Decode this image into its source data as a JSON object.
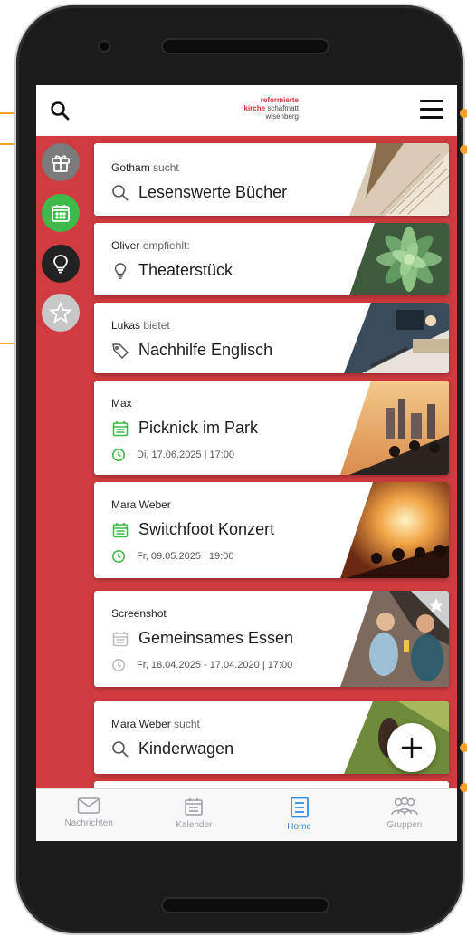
{
  "logo": {
    "line1": "reformierte",
    "line2a": "kirche",
    "line2b": "schafmatt",
    "line3": "wisenberg"
  },
  "accent": "#cf3b3f",
  "active_color": "#2f8fe8",
  "filters": [
    {
      "icon": "gift-icon",
      "color": "#7b7b7b"
    },
    {
      "icon": "calendar-icon",
      "color": "#3fb94a"
    },
    {
      "icon": "lightbulb-icon",
      "color": "#222222"
    },
    {
      "icon": "star-icon",
      "color": "#c7c7c7"
    }
  ],
  "cards": [
    {
      "author": "Gotham",
      "verb": "sucht",
      "icon": "search-icon",
      "title": "Lesenswerte Bücher"
    },
    {
      "author": "Oliver",
      "verb": "empfiehlt:",
      "icon": "lightbulb-icon",
      "title": "Theaterstück"
    },
    {
      "author": "Lukas",
      "verb": "bietet",
      "icon": "tag-icon",
      "title": "Nachhilfe Englisch"
    },
    {
      "author": "Max",
      "verb": "",
      "icon": "calendar-icon",
      "title": "Picknick im Park",
      "date": "Di, 17.06.2025 | 17:00"
    },
    {
      "author": "Mara Weber",
      "verb": "",
      "icon": "calendar-icon",
      "title": "Switchfoot Konzert",
      "date": "Fr, 09.05.2025 | 19:00"
    },
    {
      "author": "Screenshot",
      "verb": "",
      "icon": "calendar-icon",
      "title": "Gemeinsames Essen",
      "date": "Fr, 18.04.2025 - 17.04.2020 | 17:00",
      "starred": true
    },
    {
      "author": "Mara Weber",
      "verb": "sucht",
      "icon": "search-icon",
      "title": "Kinderwagen"
    }
  ],
  "nav": [
    {
      "label": "Nachrichten",
      "icon": "mail-icon"
    },
    {
      "label": "Kalender",
      "icon": "calendar-icon"
    },
    {
      "label": "Home",
      "icon": "list-icon",
      "active": true
    },
    {
      "label": "Gruppen",
      "icon": "group-icon"
    }
  ],
  "fab": {
    "icon": "plus-icon"
  }
}
